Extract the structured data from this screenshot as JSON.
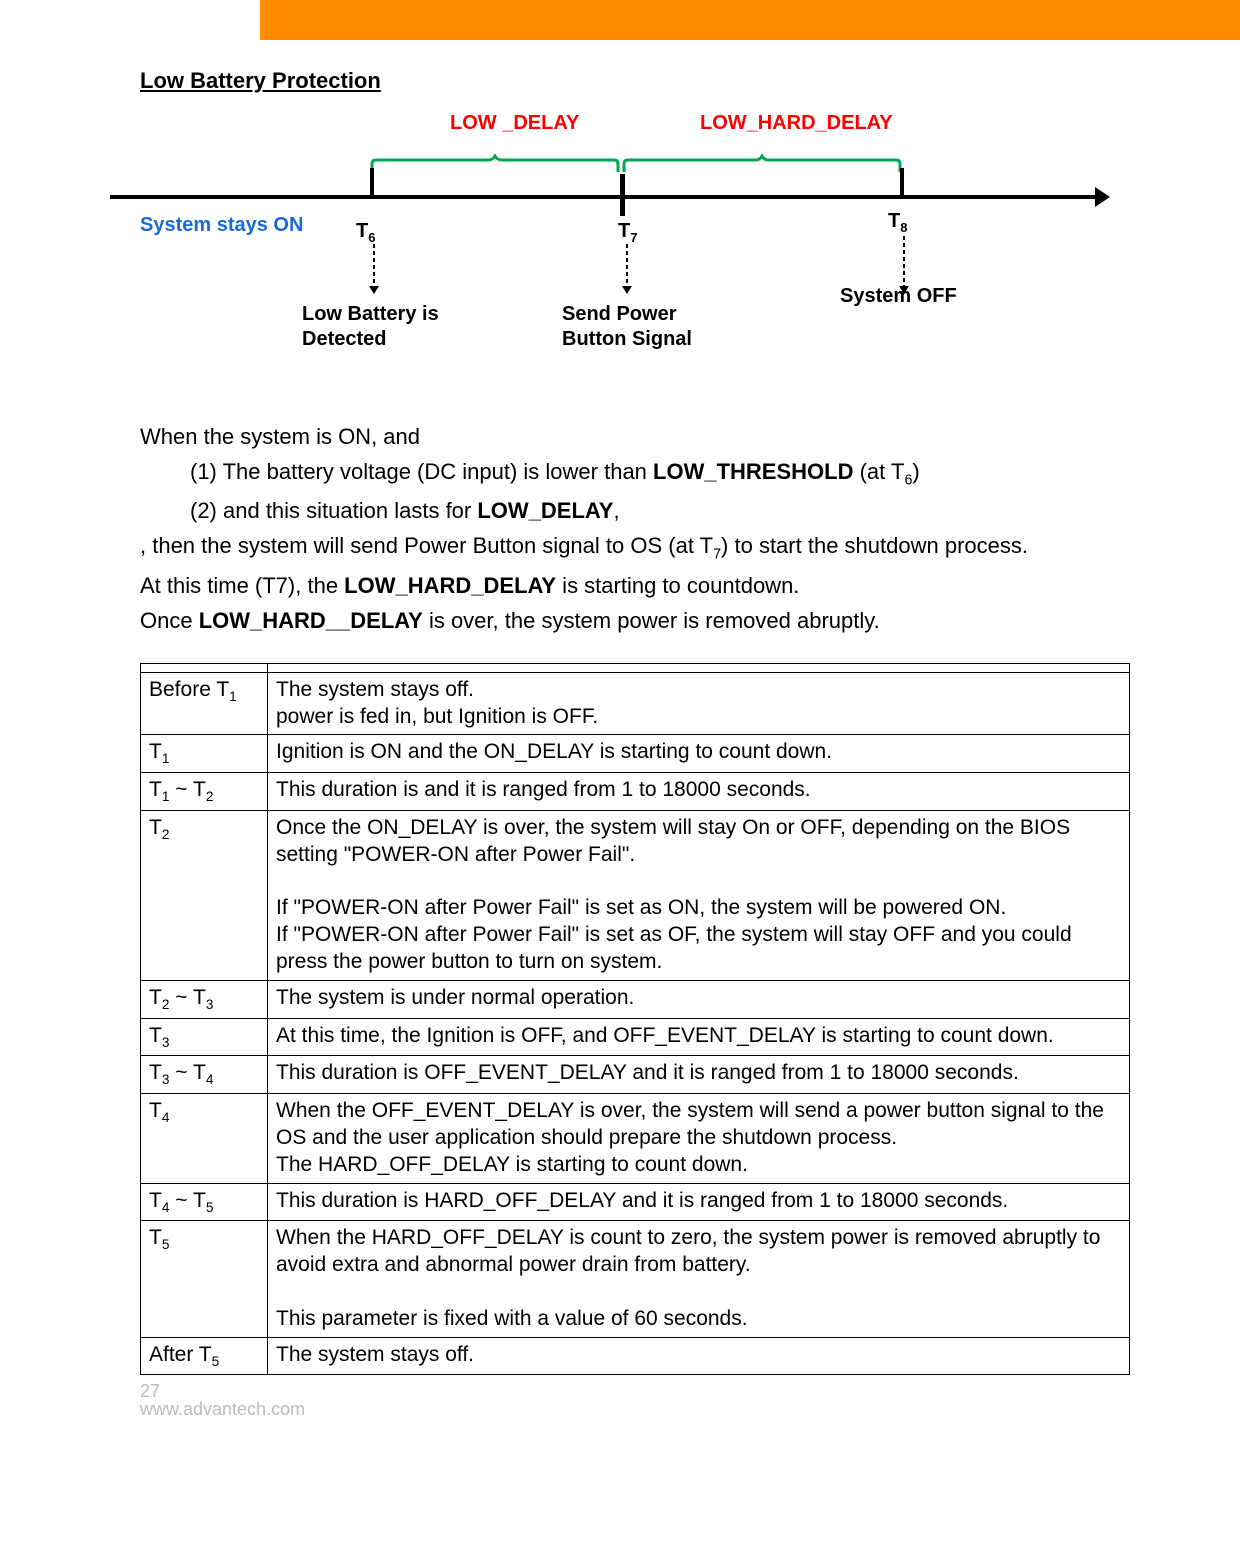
{
  "section_title": "Low Battery Protection",
  "diagram": {
    "low_delay_label": "LOW _DELAY",
    "low_hard_delay_label": "LOW_HARD_DELAY",
    "system_stays_on": "System stays ON",
    "t6": "T",
    "t6_sub": "6",
    "t7": "T",
    "t7_sub": "7",
    "t8": "T",
    "t8_sub": "8",
    "evt_t6": "Low Battery is Detected",
    "evt_t7": "Send Power Button Signal",
    "evt_t8": "System OFF"
  },
  "body": {
    "l1": "When the system is ON, and",
    "l2a": "(1) The battery voltage (DC input) is lower than ",
    "l2b": "LOW_THRESHOLD",
    "l2c": " (at T",
    "l2d": "6",
    "l2e": ")",
    "l3a": "(2) and this situation lasts for ",
    "l3b": "LOW_DELAY",
    "l3c": ",",
    "l4a": ", then the system will send Power Button signal to OS (at T",
    "l4b": "7",
    "l4c": ") to start the shutdown process.",
    "l5a": "At this time (T7), the ",
    "l5b": "LOW_HARD_DELAY",
    "l5c": " is starting to countdown.",
    "l6a": "Once ",
    "l6b": "LOW_HARD__DELAY",
    "l6c": " is over, the system power is removed abruptly."
  },
  "table": {
    "r0c0": "Before    T",
    "r0c0sub": "1",
    "r0c1a": "The system stays off.",
    "r0c1b": "power is fed in, but Ignition is OFF.",
    "r1c0": "T",
    "r1c0sub": "1",
    "r1c1a": "Ignition is ON and the ",
    "r1c1b": "ON_DELAY",
    "r1c1c": " is starting to count down.",
    "r2c0a": "T",
    "r2c0asub": "1",
    "r2c0b": " ~ T",
    "r2c0bsub": "2",
    "r2c1": "This duration is and it is ranged from 1 to 18000 seconds.",
    "r3c0": "T",
    "r3c0sub": "2",
    "r3c1a": "Once the ",
    "r3c1b": "ON_DELAY",
    "r3c1c": " is over, the system will stay On or OFF, depending on the BIOS setting \"POWER-ON after Power Fail\".",
    "r3c1d": "If \"POWER-ON after Power Fail\" is set as ON, the system will be powered ON.",
    "r3c1e": "If \"POWER-ON after Power Fail\" is set as OF, the system will stay OFF and you could press the power button to turn on system.",
    "r4c0a": "T",
    "r4c0asub": "2",
    "r4c0b": " ~ T",
    "r4c0bsub": "3",
    "r4c1": "The system is under normal operation.",
    "r5c0": "T",
    "r5c0sub": "3",
    "r5c1a": "At this time, the Ignition is OFF, and ",
    "r5c1b": "OFF_EVENT_DELAY",
    "r5c1c": " is starting to count down.",
    "r6c0a": "T",
    "r6c0asub": "3",
    "r6c0b": " ~ T",
    "r6c0bsub": "4",
    "r6c1a": "This duration is ",
    "r6c1b": "OFF_EVENT_DELAY",
    "r6c1c": " and it is ranged from 1 to 18000 seconds.",
    "r7c0": "T",
    "r7c0sub": "4",
    "r7c1a": "When the ",
    "r7c1b": "OFF_EVENT_DELAY",
    "r7c1c": " is over, the system will send a power button signal to the OS and the user application should prepare the shutdown process.",
    "r7c1d": "The ",
    "r7c1e": "HARD_OFF_DELAY",
    "r7c1f": " is starting to count down.",
    "r8c0a": "T",
    "r8c0asub": "4",
    "r8c0b": " ~ T",
    "r8c0bsub": "5",
    "r8c1a": "This duration is ",
    "r8c1b": "HARD_OFF_DELAY",
    "r8c1c": " and it is ranged from 1 to 18000 seconds.",
    "r9c0": "T",
    "r9c0sub": "5",
    "r9c1a": "When the ",
    "r9c1b": "HARD_OFF_DELAY",
    "r9c1c": " is count to zero, the system power is removed abruptly to avoid extra and abnormal power drain from battery.",
    "r9c1d": "This parameter is fixed with a value of 60 seconds.",
    "r10c0a": "After T",
    "r10c0asub": "5",
    "r10c1": "The system stays off."
  },
  "footer": {
    "page": "27",
    "brand": "www.advantech.com"
  }
}
